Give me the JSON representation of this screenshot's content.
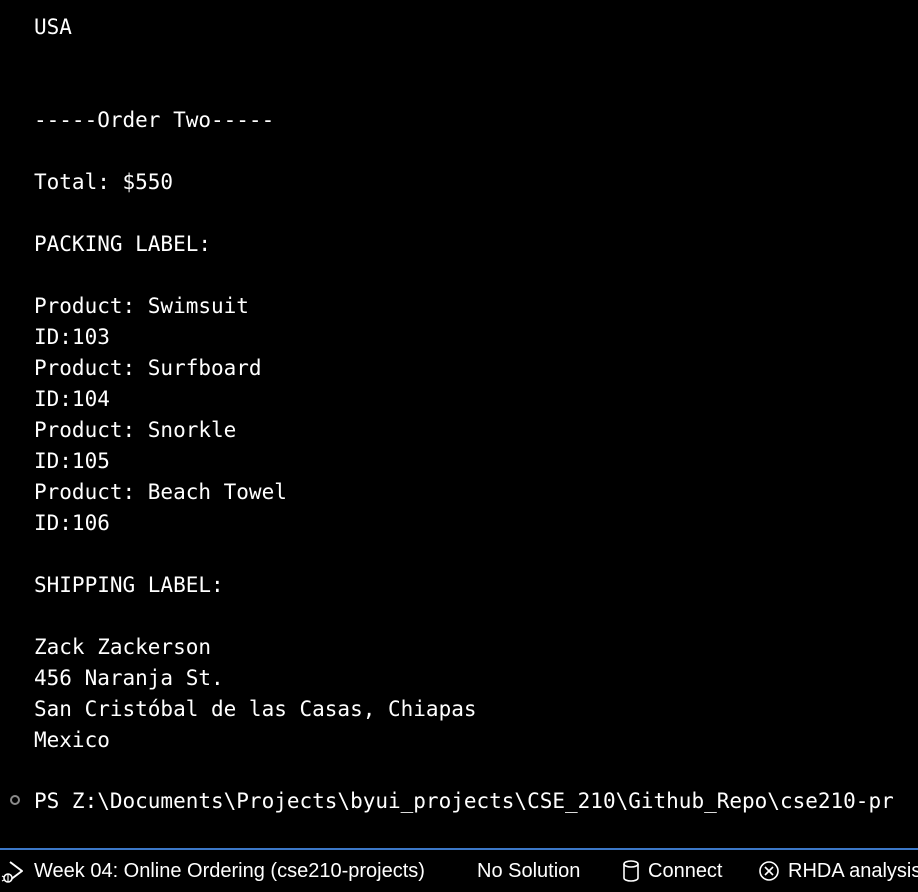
{
  "terminal": {
    "lines": [
      "USA",
      "-----Order Two-----",
      "Total: $550",
      "PACKING LABEL:",
      "Product: Swimsuit",
      "ID:103",
      "Product: Surfboard",
      "ID:104",
      "Product: Snorkle",
      "ID:105",
      "Product: Beach Towel",
      "ID:106",
      "SHIPPING LABEL:",
      "Zack Zackerson",
      "456 Naranja St.",
      "San Cristóbal de las Casas, Chiapas",
      "Mexico"
    ],
    "prompt": "PS Z:\\Documents\\Projects\\byui_projects\\CSE_210\\Github_Repo\\cse210-pr"
  },
  "statusbar": {
    "launch_label": "Week 04: Online Ordering (cse210-projects)",
    "solution_label": "No Solution",
    "connect_label": "Connect",
    "rhda_label": "RHDA analysis",
    "debug_icon": "debug-run-icon",
    "database_icon": "database-icon",
    "rhda_icon": "circle-x-icon",
    "border_color": "#3c78c8"
  }
}
